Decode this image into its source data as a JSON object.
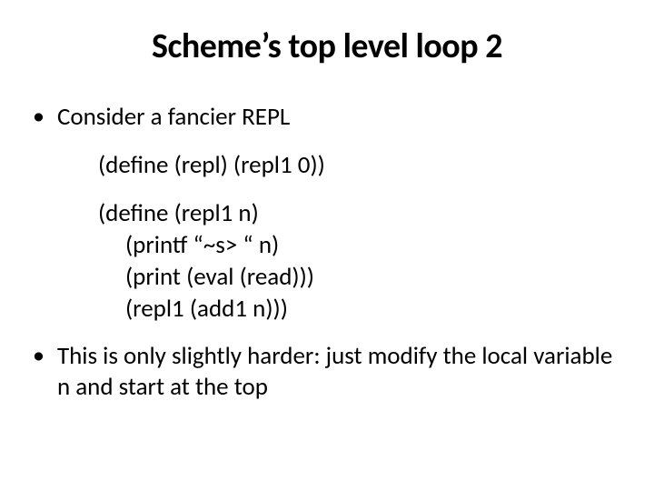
{
  "title": "Scheme’s top level loop 2",
  "bullets": {
    "first": "Consider a fancier REPL",
    "last": "This is only slightly harder: just modify the local variable n and start at the top"
  },
  "code": {
    "block1": {
      "line1": "(define (repl) (repl1 0))"
    },
    "block2": {
      "line1": "(define (repl1 n)",
      "line2": "(printf “~s> “ n)",
      "line3": "(print (eval (read)))",
      "line4": "(repl1 (add1 n)))"
    }
  }
}
